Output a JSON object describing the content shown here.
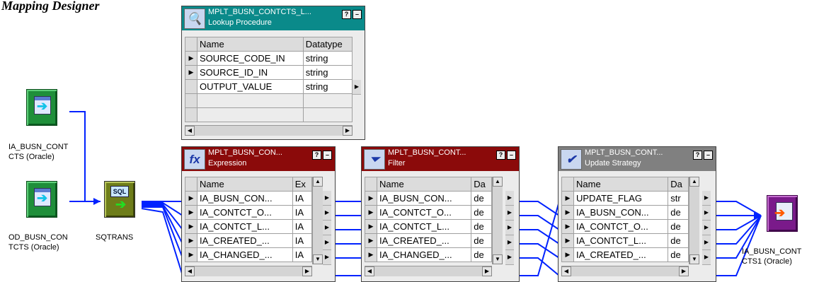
{
  "page_title": "Mapping Designer",
  "sources": [
    {
      "label_line1": "IA_BUSN_CONT",
      "label_line2": "CTS (Oracle)"
    },
    {
      "label_line1": "OD_BUSN_CON",
      "label_line2": "TCTS (Oracle)"
    }
  ],
  "source_qualifier": {
    "label": "SQTRANS",
    "icon_text": "SQL"
  },
  "target": {
    "label_line1": "IA_BUSN_CONT",
    "label_line2": "CTS1 (Oracle)"
  },
  "lookup": {
    "title": "MPLT_BUSN_CONTCTS_L...",
    "type": "Lookup Procedure",
    "col_name": "Name",
    "col_type": "Datatype",
    "rows": [
      {
        "name": "SOURCE_CODE_IN",
        "type": "string"
      },
      {
        "name": "SOURCE_ID_IN",
        "type": "string"
      },
      {
        "name": "OUTPUT_VALUE",
        "type": "string"
      }
    ]
  },
  "expression": {
    "title": "MPLT_BUSN_CON...",
    "type": "Expression",
    "icon": "fx",
    "col_name": "Name",
    "col_type": "Ex",
    "rows": [
      {
        "name": "IA_BUSN_CON...",
        "type": "IA"
      },
      {
        "name": "IA_CONTCT_O...",
        "type": "IA"
      },
      {
        "name": "IA_CONTCT_L...",
        "type": "IA"
      },
      {
        "name": "IA_CREATED_...",
        "type": "IA"
      },
      {
        "name": "IA_CHANGED_...",
        "type": "IA"
      }
    ]
  },
  "filter": {
    "title": "MPLT_BUSN_CONT...",
    "type": "Filter",
    "col_name": "Name",
    "col_type": "Da",
    "rows": [
      {
        "name": "IA_BUSN_CON...",
        "type": "de"
      },
      {
        "name": "IA_CONTCT_O...",
        "type": "de"
      },
      {
        "name": "IA_CONTCT_L...",
        "type": "de"
      },
      {
        "name": "IA_CREATED_...",
        "type": "de"
      },
      {
        "name": "IA_CHANGED_...",
        "type": "de"
      }
    ]
  },
  "update_strategy": {
    "title": "MPLT_BUSN_CONT...",
    "type": "Update Strategy",
    "col_name": "Name",
    "col_type": "Da",
    "rows": [
      {
        "name": "UPDATE_FLAG",
        "type": "str"
      },
      {
        "name": "IA_BUSN_CON...",
        "type": "de"
      },
      {
        "name": "IA_CONTCT_O...",
        "type": "de"
      },
      {
        "name": "IA_CONTCT_L...",
        "type": "de"
      },
      {
        "name": "IA_CREATED_...",
        "type": "de"
      }
    ]
  },
  "colors": {
    "lookup_header": "#0a8a8a",
    "expression_header": "#8b0a0a",
    "filter_header": "#8b0a0a",
    "update_header": "#808080",
    "link_color": "#0022ff"
  }
}
